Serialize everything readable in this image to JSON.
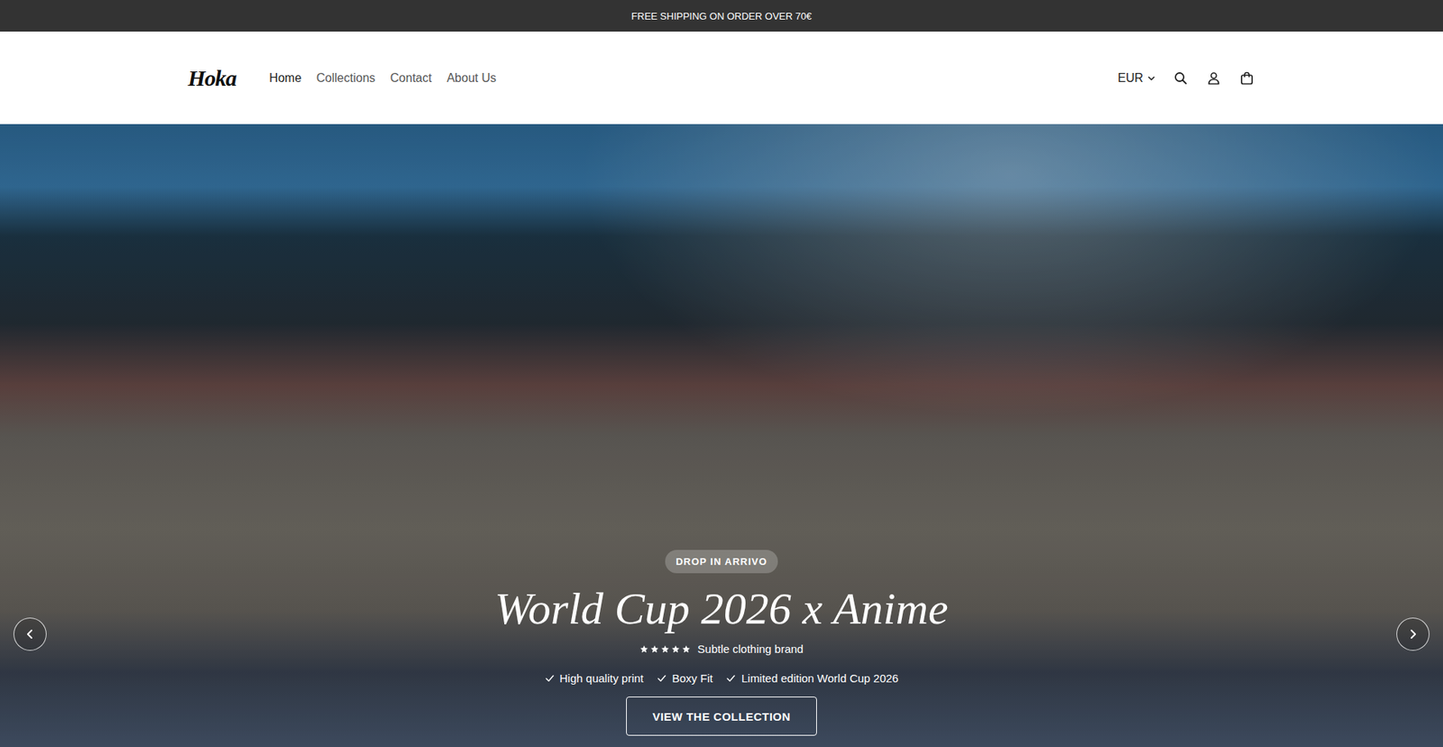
{
  "announcement": "FREE SHIPPING ON ORDER OVER 70€",
  "logo": "Hoka",
  "nav": [
    {
      "label": "Home",
      "selected": true
    },
    {
      "label": "Collections",
      "selected": false
    },
    {
      "label": "Contact",
      "selected": false
    },
    {
      "label": "About Us",
      "selected": false
    }
  ],
  "currency": "EUR",
  "hero": {
    "badge": "DROP IN ARRIVO",
    "title": "World Cup 2026 x Anime",
    "stars": 5,
    "tagline": "Subtle clothing brand",
    "features": [
      "High quality print",
      "Boxy Fit",
      "Limited edition World Cup 2026"
    ],
    "button": "VIEW THE COLLECTION"
  }
}
